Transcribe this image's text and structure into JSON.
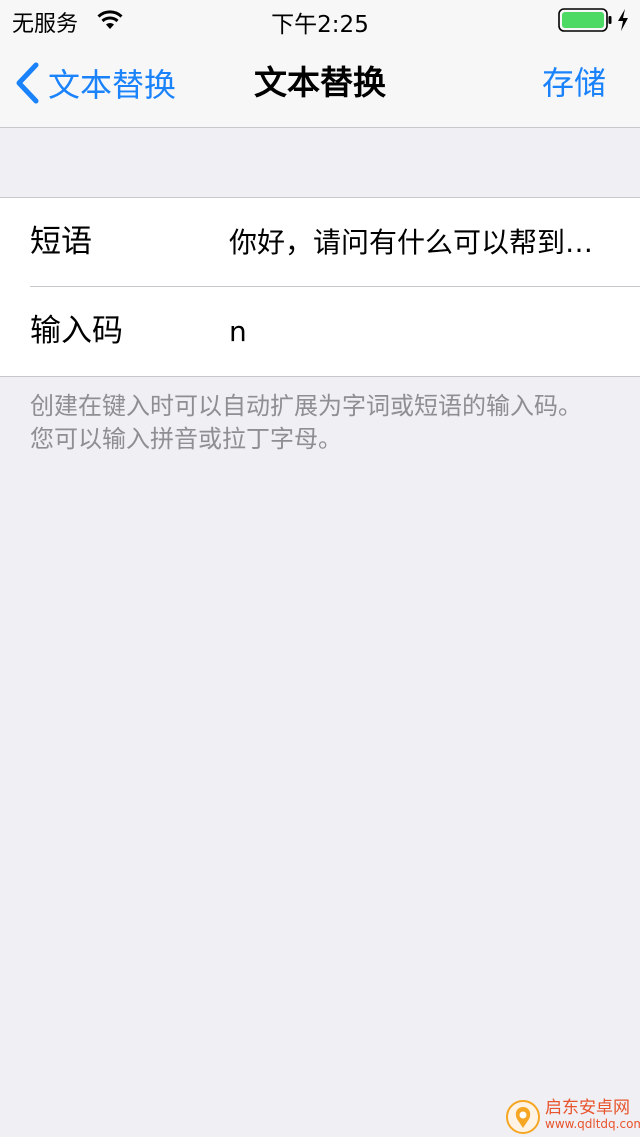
{
  "status_bar": {
    "carrier": "无服务",
    "time": "下午2:25",
    "wifi_icon": "wifi-icon",
    "battery_icon": "battery-icon",
    "charging_icon": "bolt-icon",
    "battery_color": "#4cd964"
  },
  "nav": {
    "back_label": "文本替换",
    "title": "文本替换",
    "save_label": "存储",
    "accent_color": "#1a82fb"
  },
  "form": {
    "phrase": {
      "label": "短语",
      "value": "你好，请问有什么可以帮到…"
    },
    "shortcut": {
      "label": "输入码",
      "value": "n"
    }
  },
  "footer_note": "创建在键入时可以自动扩展为字词或短语的输入码。您可以输入拼音或拉丁字母。",
  "watermark": {
    "name": "启东安卓网",
    "url": "www.qdltdq.com"
  }
}
